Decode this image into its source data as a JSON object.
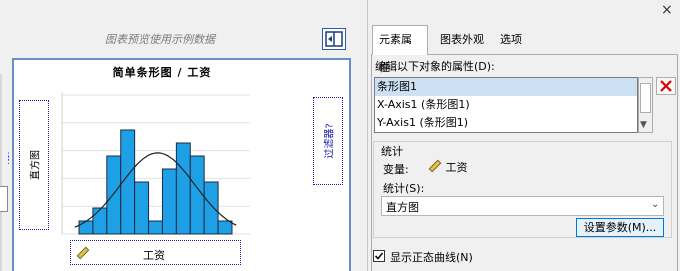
{
  "preview": {
    "caption": "图表预览使用示例数据",
    "chart_title": "简单条形图 / 工资",
    "y_drop_zone": "直方图",
    "group_drop_zone": "过滤器?",
    "x_drop_zone": "工资"
  },
  "chart_data": {
    "type": "bar",
    "title": "简单条形图 / 工资",
    "xlabel": "工资",
    "ylabel": "直方图",
    "values": [
      1,
      2,
      6,
      8,
      4,
      1,
      5,
      7,
      6,
      4,
      1
    ],
    "normal_curve": true,
    "note": "preview uses sample data"
  },
  "close_label": "×",
  "tabs": [
    "元素属性",
    "图表外观",
    "选项"
  ],
  "properties": {
    "edit_label": "编辑以下对象的属性(D):",
    "objects": [
      "条形图1",
      "X-Axis1 (条形图1)",
      "Y-Axis1 (条形图1)"
    ],
    "stats": {
      "title": "统计",
      "variable_label": "变量:",
      "variable_value": "工资",
      "statistic_label": "统计(S):",
      "statistic_value": "直方图",
      "params_button": "设置参数(M)..."
    },
    "normal_curve_label": "显示正态曲线(N)",
    "normal_curve_checked": true
  },
  "colors": {
    "bar_fill": "#1ea0e6",
    "accent": "#0078d7",
    "delete_red": "#d40000"
  }
}
